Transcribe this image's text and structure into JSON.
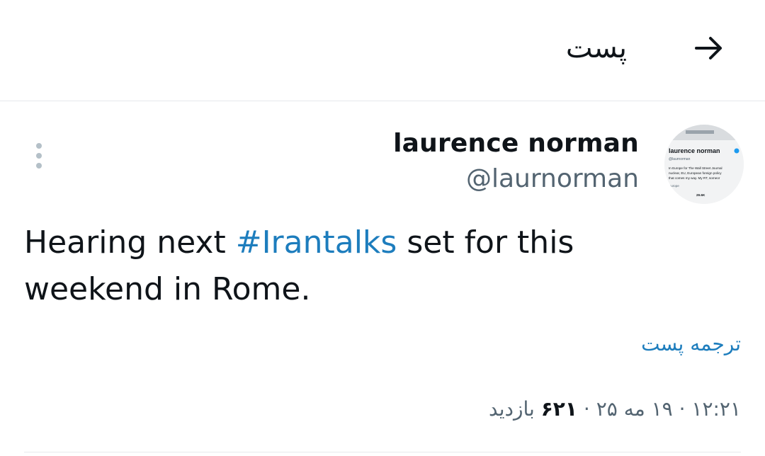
{
  "header": {
    "title": "پست",
    "back_icon": "arrow-right-icon"
  },
  "tweet": {
    "author": {
      "display_name": "laurence norman",
      "username": "@laurnorman",
      "avatar_preview": {
        "name": "laurence norman",
        "handle": "@laurnorman",
        "bio": "In Europe for The Wall Street Journal. nuclear, EU, European foreign policy that comes my way. My RT, someon",
        "meta": "Europe",
        "stats": "29.6K"
      }
    },
    "text_before": "Hearing next ",
    "hashtag": "#Irantalks",
    "text_after": " set for this weekend in Rome.",
    "translate_label": "ترجمه پست",
    "time": "۱۲:۲۱",
    "date": "۱۹ مه ۲۵",
    "views_count": "۶۲۱",
    "views_label": "بازدید",
    "separator": "·"
  },
  "colors": {
    "accent": "#1d7dbd",
    "text": "#0f1419",
    "muted": "#536471",
    "divider": "#e6e9ec"
  }
}
